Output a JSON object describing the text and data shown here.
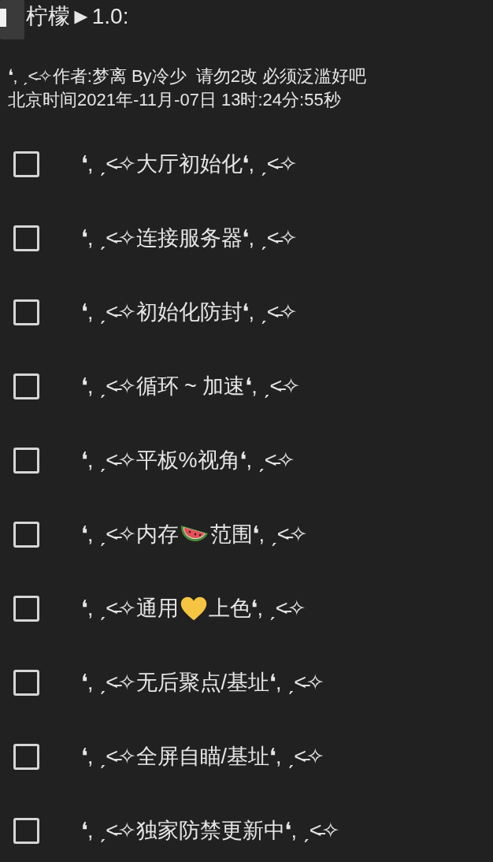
{
  "panel": {
    "title": "柠檬►1.0:"
  },
  "info": [
    "❛‚ ˏ˂̵✧作者:梦离 By冷少  请勿2改 必须泛滥好吧",
    "北京时间2021年-11月-07日 13时:24分:55秒"
  ],
  "items": [
    {
      "checked": false,
      "segments": [
        {
          "kind": "text",
          "text": "❛‚ ˏ˂̵✧大厅初始化❛‚ ˏ˂̵✧"
        }
      ]
    },
    {
      "checked": false,
      "segments": [
        {
          "kind": "text",
          "text": "❛‚ ˏ˂̵✧连接服务器❛‚ ˏ˂̵✧"
        }
      ]
    },
    {
      "checked": false,
      "segments": [
        {
          "kind": "text",
          "text": "❛‚ ˏ˂̵✧初始化防封❛‚ ˏ˂̵✧"
        }
      ]
    },
    {
      "checked": false,
      "segments": [
        {
          "kind": "text",
          "text": "❛‚ ˏ˂̵✧循环 ~ 加速❛‚ ˏ˂̵✧"
        }
      ]
    },
    {
      "checked": false,
      "segments": [
        {
          "kind": "text",
          "text": "❛‚ ˏ˂̵✧平板%视角❛‚ ˏ˂̵✧"
        }
      ]
    },
    {
      "checked": false,
      "segments": [
        {
          "kind": "text",
          "text": "❛‚ ˏ˂̵✧内存"
        },
        {
          "kind": "watermelon"
        },
        {
          "kind": "text",
          "text": "范围❛‚ ˏ˂̵✧"
        }
      ]
    },
    {
      "checked": false,
      "segments": [
        {
          "kind": "text",
          "text": "❛‚ ˏ˂̵✧通用"
        },
        {
          "kind": "heart"
        },
        {
          "kind": "text",
          "text": "上色❛‚ ˏ˂̵✧"
        }
      ]
    },
    {
      "checked": false,
      "segments": [
        {
          "kind": "text",
          "text": "❛‚ ˏ˂̵✧无后聚点/基址❛‚ ˏ˂̵✧"
        }
      ]
    },
    {
      "checked": false,
      "segments": [
        {
          "kind": "text",
          "text": "❛‚ ˏ˂̵✧全屏自瞄/基址❛‚ ˏ˂̵✧"
        }
      ]
    },
    {
      "checked": false,
      "segments": [
        {
          "kind": "text",
          "text": "❛‚ ˏ˂̵✧独家防禁更新中❛‚ ˏ˂̵✧"
        }
      ]
    }
  ]
}
